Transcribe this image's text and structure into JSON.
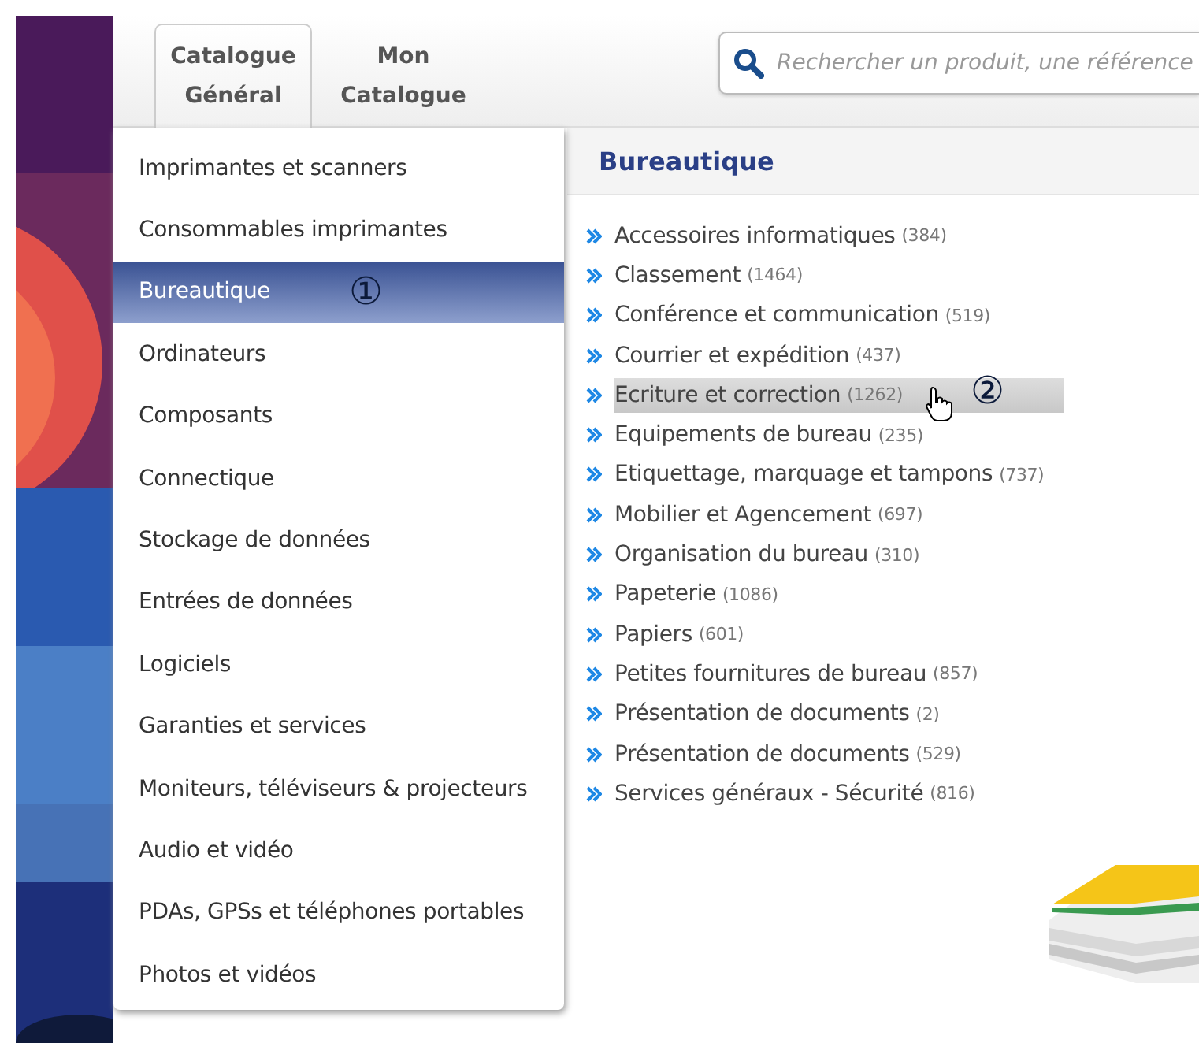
{
  "tabs": [
    {
      "label": "Catalogue Général",
      "selected": true
    },
    {
      "label": "Mon Catalogue",
      "selected": false
    }
  ],
  "search": {
    "placeholder": "Rechercher un produit, une référence"
  },
  "menu": {
    "items": [
      {
        "label": "Imprimantes et scanners",
        "selected": false
      },
      {
        "label": "Consommables imprimantes",
        "selected": false
      },
      {
        "label": "Bureautique",
        "selected": true,
        "callout": "①"
      },
      {
        "label": "Ordinateurs",
        "selected": false
      },
      {
        "label": "Composants",
        "selected": false
      },
      {
        "label": "Connectique",
        "selected": false
      },
      {
        "label": "Stockage de données",
        "selected": false
      },
      {
        "label": "Entrées de données",
        "selected": false
      },
      {
        "label": "Logiciels",
        "selected": false
      },
      {
        "label": "Garanties et services",
        "selected": false
      },
      {
        "label": "Moniteurs, téléviseurs & projecteurs",
        "selected": false
      },
      {
        "label": "Audio et vidéo",
        "selected": false
      },
      {
        "label": "PDAs, GPSs et téléphones portables",
        "selected": false
      },
      {
        "label": "Photos et vidéos",
        "selected": false
      }
    ]
  },
  "panel": {
    "title": "Bureautique",
    "items": [
      {
        "label": "Accessoires informatiques",
        "count": "(384)",
        "hovered": false
      },
      {
        "label": "Classement",
        "count": "(1464)",
        "hovered": false
      },
      {
        "label": "Conférence et communication",
        "count": "(519)",
        "hovered": false
      },
      {
        "label": "Courrier et expédition",
        "count": "(437)",
        "hovered": false
      },
      {
        "label": "Ecriture et correction",
        "count": "(1262)",
        "hovered": true,
        "callout": "②"
      },
      {
        "label": "Equipements de bureau",
        "count": "(235)",
        "hovered": false
      },
      {
        "label": "Etiquettage, marquage et tampons",
        "count": "(737)",
        "hovered": false
      },
      {
        "label": "Mobilier et Agencement",
        "count": "(697)",
        "hovered": false
      },
      {
        "label": "Organisation du bureau",
        "count": "(310)",
        "hovered": false
      },
      {
        "label": "Papeterie",
        "count": "(1086)",
        "hovered": false
      },
      {
        "label": "Papiers",
        "count": "(601)",
        "hovered": false
      },
      {
        "label": "Petites fournitures de bureau",
        "count": "(857)",
        "hovered": false
      },
      {
        "label": "Présentation de documents",
        "count": "(2)",
        "hovered": false
      },
      {
        "label": "Présentation de documents",
        "count": "(529)",
        "hovered": false
      },
      {
        "label": "Services généraux - Sécurité",
        "count": "(816)",
        "hovered": false
      }
    ]
  }
}
